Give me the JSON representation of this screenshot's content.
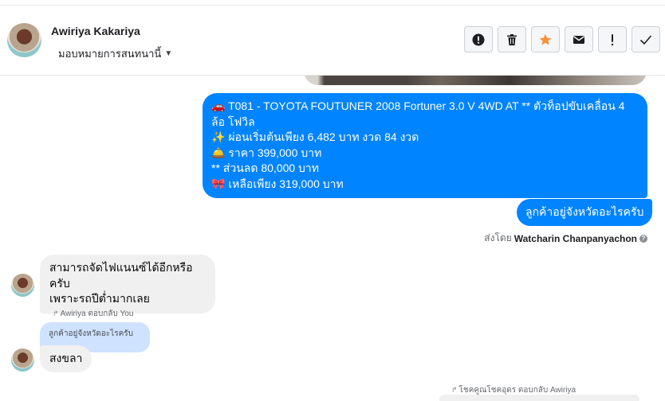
{
  "header": {
    "contact_name": "Awiriya Kakariya",
    "assign_label": "มอบหมายการสนทนานี้",
    "actions": [
      {
        "name": "spam-button",
        "icon": "exclamation-circle-icon"
      },
      {
        "name": "delete-button",
        "icon": "trash-icon"
      },
      {
        "name": "star-button",
        "icon": "star-icon",
        "color": "#f7923b"
      },
      {
        "name": "mark-unread-button",
        "icon": "envelope-icon"
      },
      {
        "name": "follow-up-button",
        "icon": "exclamation-icon"
      },
      {
        "name": "done-button",
        "icon": "check-icon"
      }
    ]
  },
  "messages": {
    "outgoing_main": {
      "line1": "🚗 T081 - TOYOTA FOUTUNER 2008 Fortuner 3.0 V 4WD AT ** ตัวท็อปขับเคลื่อน 4 ล้อ โฟวิล",
      "line2": "✨ ผ่อนเริ่มต้นเพียง 6,482 บาท งวด 84 งวด",
      "line3": "🛎️ ราคา 399,000 บาท",
      "line4": "** ส่วนลด 80,000 บาท",
      "line5": "🎀 เหลือเพียง 319,000 บาท"
    },
    "outgoing_second": "ลูกค้าอยู่จังหวัดอะไรครับ",
    "sent_by_prefix": "ส่งโดย",
    "sent_by_name": "Watcharin Chanpanyachon",
    "incoming_1": {
      "line1": "สามารถจัดไฟแนนซ์ได้อีกหรือครับ",
      "line2": "เพราะรถปีต่ำมากเลย"
    },
    "reply_label_1": "Awiriya ตอบกลับ You",
    "quoted_text": "ลูกค้าอยู่จังหวัดอะไรครับ",
    "incoming_2": "สงขลา",
    "reply_label_2": "โชคคูณโชคอุดร ตอบกลับ Awiriya"
  },
  "colors": {
    "outgoing_bubble": "#0084ff",
    "incoming_bubble": "#f0f0f0",
    "quoted_bubble": "#cfe2ff"
  }
}
